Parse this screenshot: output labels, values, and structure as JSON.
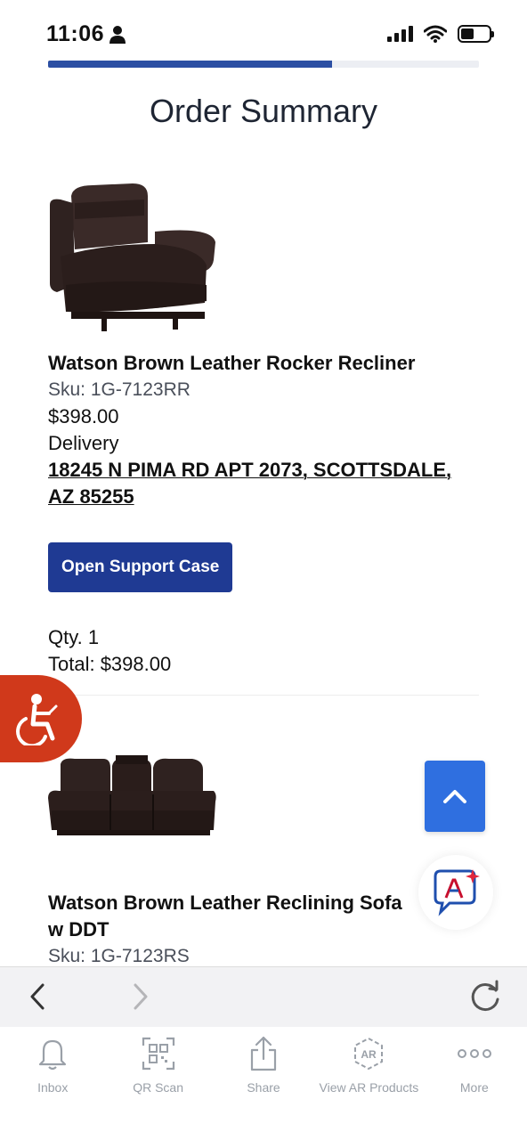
{
  "status_bar": {
    "time": "11:06"
  },
  "progress": {
    "fraction": 0.66
  },
  "page": {
    "title": "Order Summary"
  },
  "products": [
    {
      "name": "Watson Brown Leather Rocker Recliner",
      "sku": "Sku: 1G-7123RR",
      "price": "$398.00",
      "delivery_label": "Delivery",
      "address": "18245 N PIMA RD APT 2073, SCOTTSDALE, AZ 85255",
      "support_button": "Open Support Case",
      "qty": "Qty. 1",
      "total": "Total: $398.00"
    },
    {
      "name": "Watson Brown Leather Reclining Sofa w DDT",
      "sku": "Sku: 1G-7123RS"
    }
  ],
  "browser": {
    "back_icon": "chevron-left-icon",
    "forward_icon": "chevron-right-icon",
    "reload_icon": "reload-icon"
  },
  "tabs": [
    {
      "label": "Inbox",
      "icon": "bell-icon"
    },
    {
      "label": "QR Scan",
      "icon": "qr-icon"
    },
    {
      "label": "Share",
      "icon": "share-icon"
    },
    {
      "label": "View AR Products",
      "icon": "ar-icon"
    },
    {
      "label": "More",
      "icon": "more-icon"
    }
  ],
  "colors": {
    "primary_button": "#1f3a93",
    "accessibility": "#d0391b",
    "scroll_top": "#2f6fe0"
  }
}
